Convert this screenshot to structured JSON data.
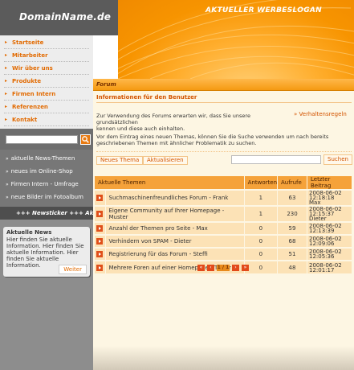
{
  "header": {
    "logo": "DomainName.de",
    "slogan": "AKTUELLER WERBESLOGAN"
  },
  "sidebar": {
    "nav": [
      {
        "label": "Startseite",
        "icon": "chevron-right-icon"
      },
      {
        "label": "Mitarbeiter",
        "icon": "chevron-right-icon"
      },
      {
        "label": "Wir über uns",
        "icon": "chevron-right-icon"
      },
      {
        "label": "Produkte",
        "icon": "chevron-right-icon"
      },
      {
        "label": "Firmen Intern",
        "icon": "chevron-right-icon"
      },
      {
        "label": "Referenzen",
        "icon": "chevron-right-icon"
      },
      {
        "label": "Kontakt",
        "icon": "chevron-right-icon"
      }
    ],
    "search": {
      "placeholder": "",
      "button_icon": "search-icon"
    },
    "links": [
      {
        "label": "aktuelle News-Themen",
        "arrow": "»"
      },
      {
        "label": "neues im Online-Shop",
        "arrow": "»"
      },
      {
        "label": "Firmen Intern - Umfrage",
        "arrow": "»"
      },
      {
        "label": "neue Bilder im Fotoalbum",
        "arrow": "»"
      }
    ],
    "ticker": "+++ Newsticker +++ Aktue",
    "news": {
      "title": "Aktuelle News",
      "text": "Hier finden Sie aktuelle Information. Hier finden Sie aktuelle Information. Hier finden Sie aktuelle Information.",
      "more_label": "Weiter"
    }
  },
  "main": {
    "section_title": "Forum",
    "info_title": "Informationen für den Benutzer",
    "intro_text": "Zur Verwendung des Forums erwarten wir, dass Sie unsere grundsätzlichen Verhaltensregeln kennen und diese auch einhalten.",
    "intro_first": "Zur Verwendung des Forums erwarten wir, dass Sie unsere grundsätzlichen",
    "intro_second": "kennen und diese auch einhalten.",
    "rules_link": "Verhaltensregeln",
    "rules_arrow": "»",
    "search_hint": "Vor dem Eintrag eines neuen Themas, können Sie die Suche verwenden um nach bereits geschriebenen Themen mit ähnlicher Problematik zu suchen.",
    "buttons": {
      "new_topic": "Neues Thema",
      "refresh": "Aktualisieren",
      "search": "Suchen"
    },
    "search": {
      "value": "",
      "placeholder": ""
    },
    "table": {
      "headers": [
        "Aktuelle Themen",
        "Antworten",
        "Aufrufe",
        "Letzter Beitrag"
      ],
      "rows": [
        {
          "title": "Suchmaschinenfreundliches Forum - Frank",
          "replies": "1",
          "views": "63",
          "last_date": "2008-06-02 12:18:18",
          "last_user": "Max"
        },
        {
          "title": "Eigene Community auf Ihrer Homepage - Muster",
          "replies": "1",
          "views": "230",
          "last_date": "2008-06-02 12:15:37",
          "last_user": "Dieter"
        },
        {
          "title": "Anzahl der Themen pro Seite - Max",
          "replies": "0",
          "views": "59",
          "last_date": "2008-06-02 12:13:39",
          "last_user": ""
        },
        {
          "title": "Verhindern von SPAM - Dieter",
          "replies": "0",
          "views": "68",
          "last_date": "2008-06-02 12:09:06",
          "last_user": ""
        },
        {
          "title": "Registrierung für das Forum - Steffi",
          "replies": "0",
          "views": "51",
          "last_date": "2008-06-02 12:05:36",
          "last_user": ""
        },
        {
          "title": "Mehrere Foren auf einer Homepage - Tester",
          "replies": "0",
          "views": "48",
          "last_date": "2008-06-02 12:01:17",
          "last_user": ""
        }
      ]
    },
    "pager": {
      "first": "«",
      "prev": "‹",
      "current": "1 / 1",
      "next": "›",
      "last": "»"
    }
  },
  "colors": {
    "accent": "#e26a00",
    "banner": "#f79400",
    "sidebar": "#8d8d8d",
    "content_bg": "#fdf6e3"
  }
}
